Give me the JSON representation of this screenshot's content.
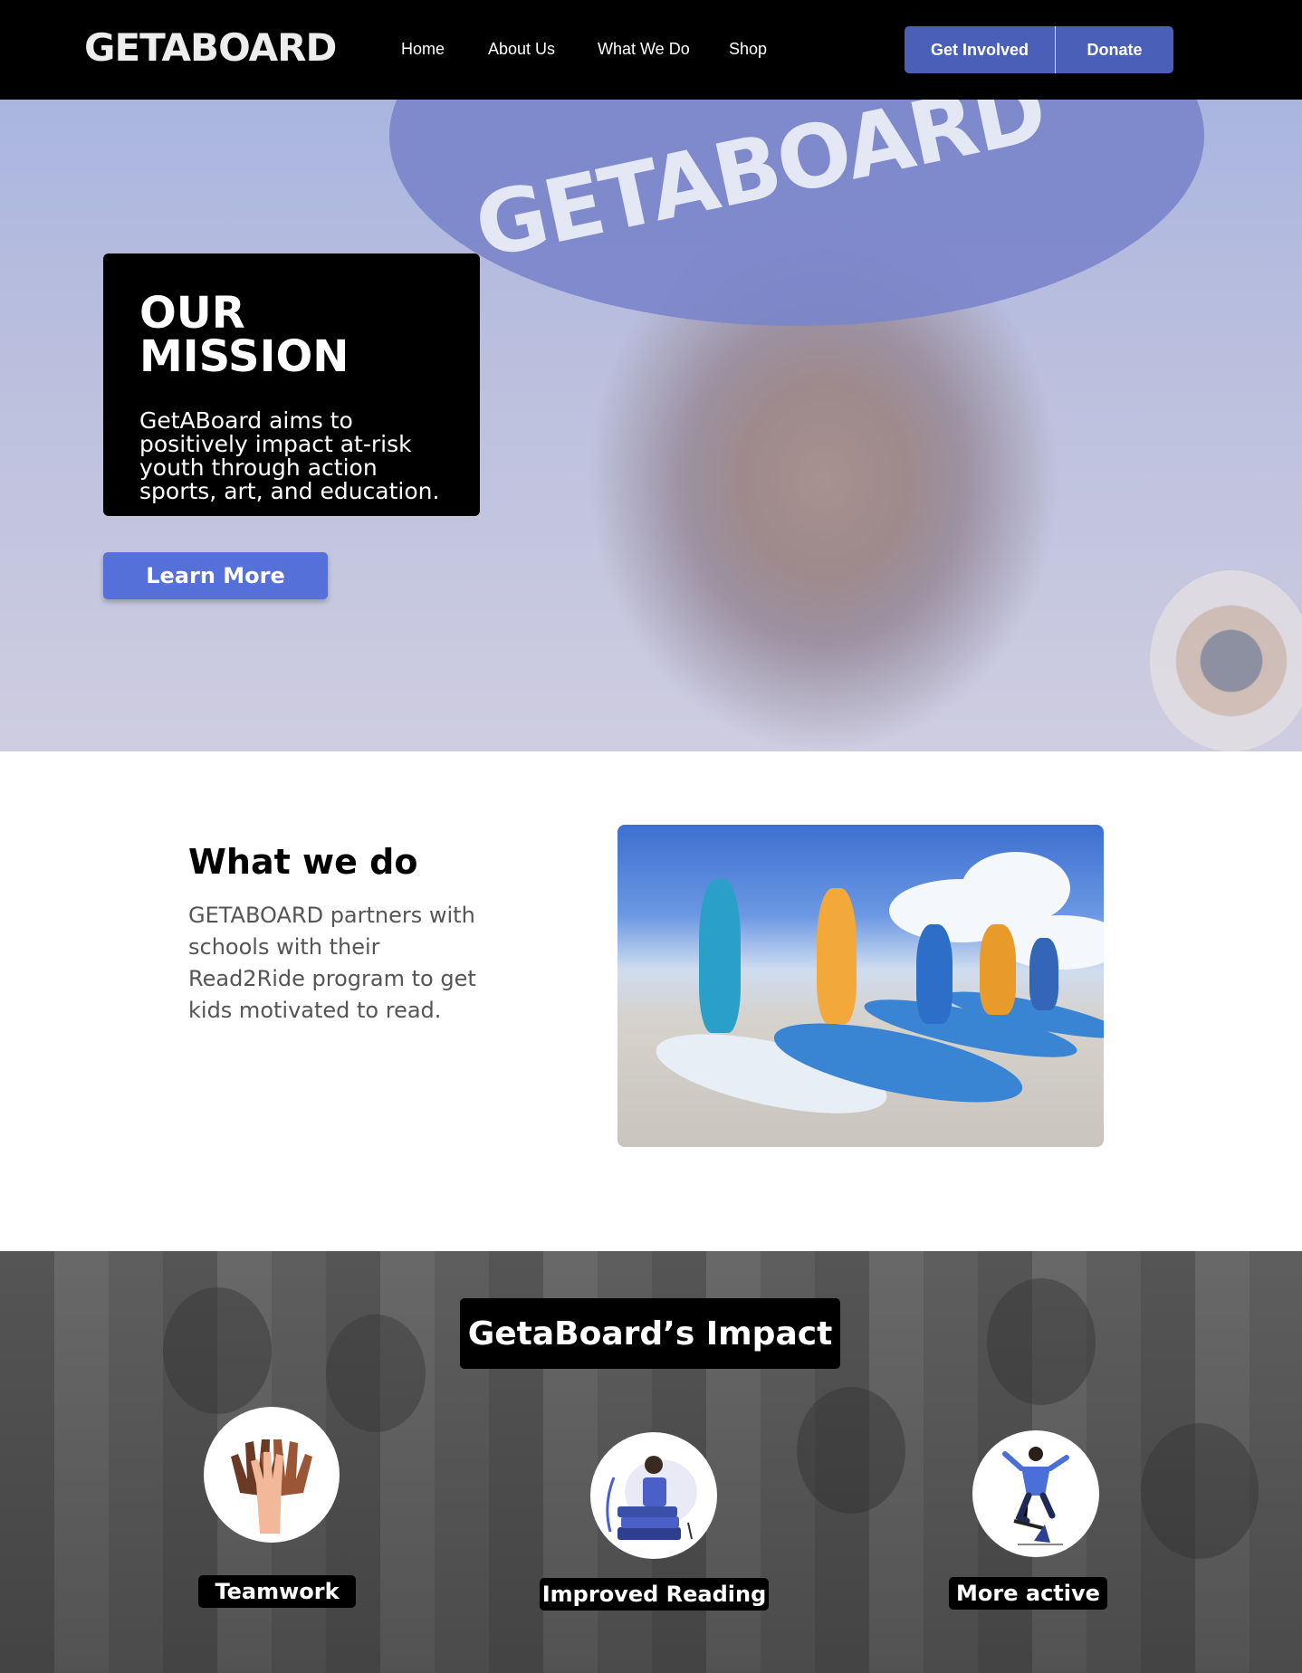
{
  "nav": {
    "logo": "GETABOARD",
    "links": [
      "Home",
      "About Us",
      "What We Do",
      "Shop"
    ],
    "get_involved": "Get Involved",
    "donate": "Donate"
  },
  "hero": {
    "helmet_text": "GETABOARD",
    "mission_title": "OUR MISSION",
    "mission_text": "GetABoard aims to positively impact at-risk youth through action sports, art, and education.",
    "learn_more": "Learn More"
  },
  "what_we_do": {
    "title": "What we do",
    "text": "GETABOARD partners with schools with their Read2Ride program to get kids motivated to read."
  },
  "impact": {
    "title": "GetaBoard’s Impact",
    "items": [
      {
        "label": "Teamwork",
        "icon": "hands-icon"
      },
      {
        "label": "Improved Reading",
        "icon": "reading-icon"
      },
      {
        "label": "More active",
        "icon": "skater-icon"
      }
    ]
  },
  "colors": {
    "accent": "#4a60b8",
    "learn_button": "#5570d8",
    "nav_bg": "#000000"
  }
}
